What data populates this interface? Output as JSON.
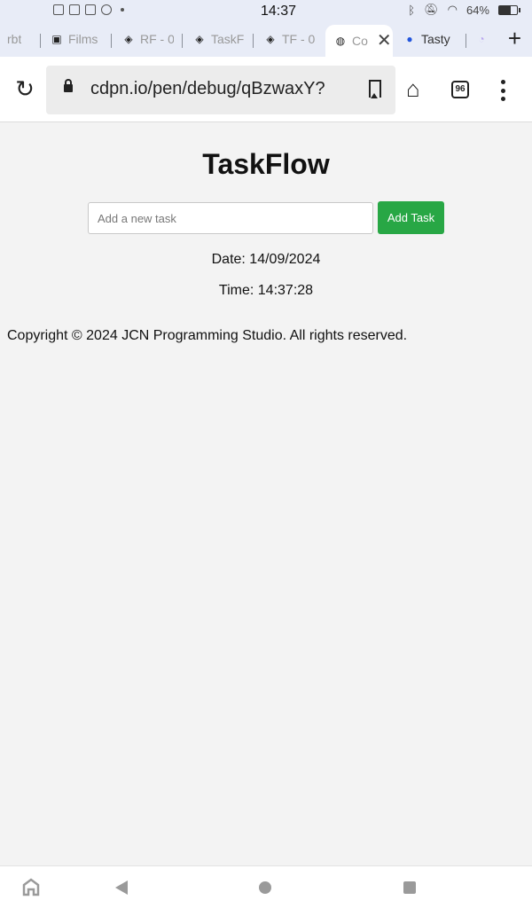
{
  "status_bar": {
    "time": "14:37",
    "battery": "64%"
  },
  "tabs": [
    {
      "title": "rbt",
      "favicon": "generic-icon"
    },
    {
      "title": "Films",
      "favicon": "tv-icon"
    },
    {
      "title": "RF - 0",
      "favicon": "codepen-icon"
    },
    {
      "title": "TaskF",
      "favicon": "codepen-icon"
    },
    {
      "title": "TF - 0",
      "favicon": "codepen-icon"
    },
    {
      "title": "Co",
      "favicon": "globe-icon",
      "active": true
    },
    {
      "title": "Tasty",
      "favicon": "tasty-icon"
    },
    {
      "title": "",
      "favicon": "circle-icon"
    }
  ],
  "toolbar": {
    "url": "cdpn.io/pen/debug/qBzwaxY?",
    "tab_count": "96"
  },
  "page": {
    "title": "TaskFlow",
    "input_placeholder": "Add a new task",
    "add_button": "Add Task",
    "date_text": "Date: 14/09/2024",
    "time_text": "Time: 14:37:28",
    "footer": "Copyright © 2024 JCN Programming Studio. All rights reserved."
  },
  "colors": {
    "add_button_bg": "#28a745",
    "page_bg": "#f3f3f3"
  }
}
